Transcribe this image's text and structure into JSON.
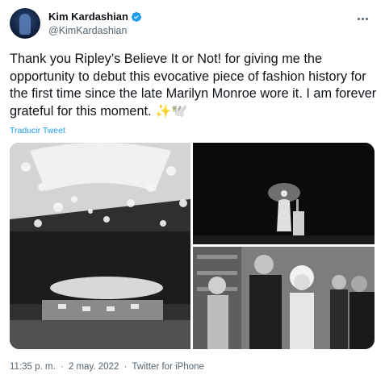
{
  "author": {
    "name": "Kim Kardashian",
    "handle": "@KimKardashian",
    "avatar_icon": "profile-photo",
    "verified_icon": "verified-badge-icon",
    "verified_color": "#1d9bf0"
  },
  "tweet": {
    "text": "Thank you Ripley’s Believe It or Not! for giving me the opportunity to debut this evocative piece of fashion history for the first time since the late Marilyn Monroe wore it. I am forever grateful for this moment. ✨🕊️",
    "translate_label": "Traducir Tweet"
  },
  "media": [
    {
      "icon": "photo-icon",
      "description_name": "photo-concert-hall"
    },
    {
      "icon": "photo-icon",
      "description_name": "photo-stage-microphone"
    },
    {
      "icon": "photo-icon",
      "description_name": "photo-group-portrait"
    }
  ],
  "footer": {
    "time": "11:35 p. m.",
    "separator": "·",
    "date": "2 may. 2022",
    "source": "Twitter for iPhone"
  },
  "colors": {
    "text": "#0f1419",
    "secondary": "#536471",
    "link": "#1d9bf0"
  }
}
